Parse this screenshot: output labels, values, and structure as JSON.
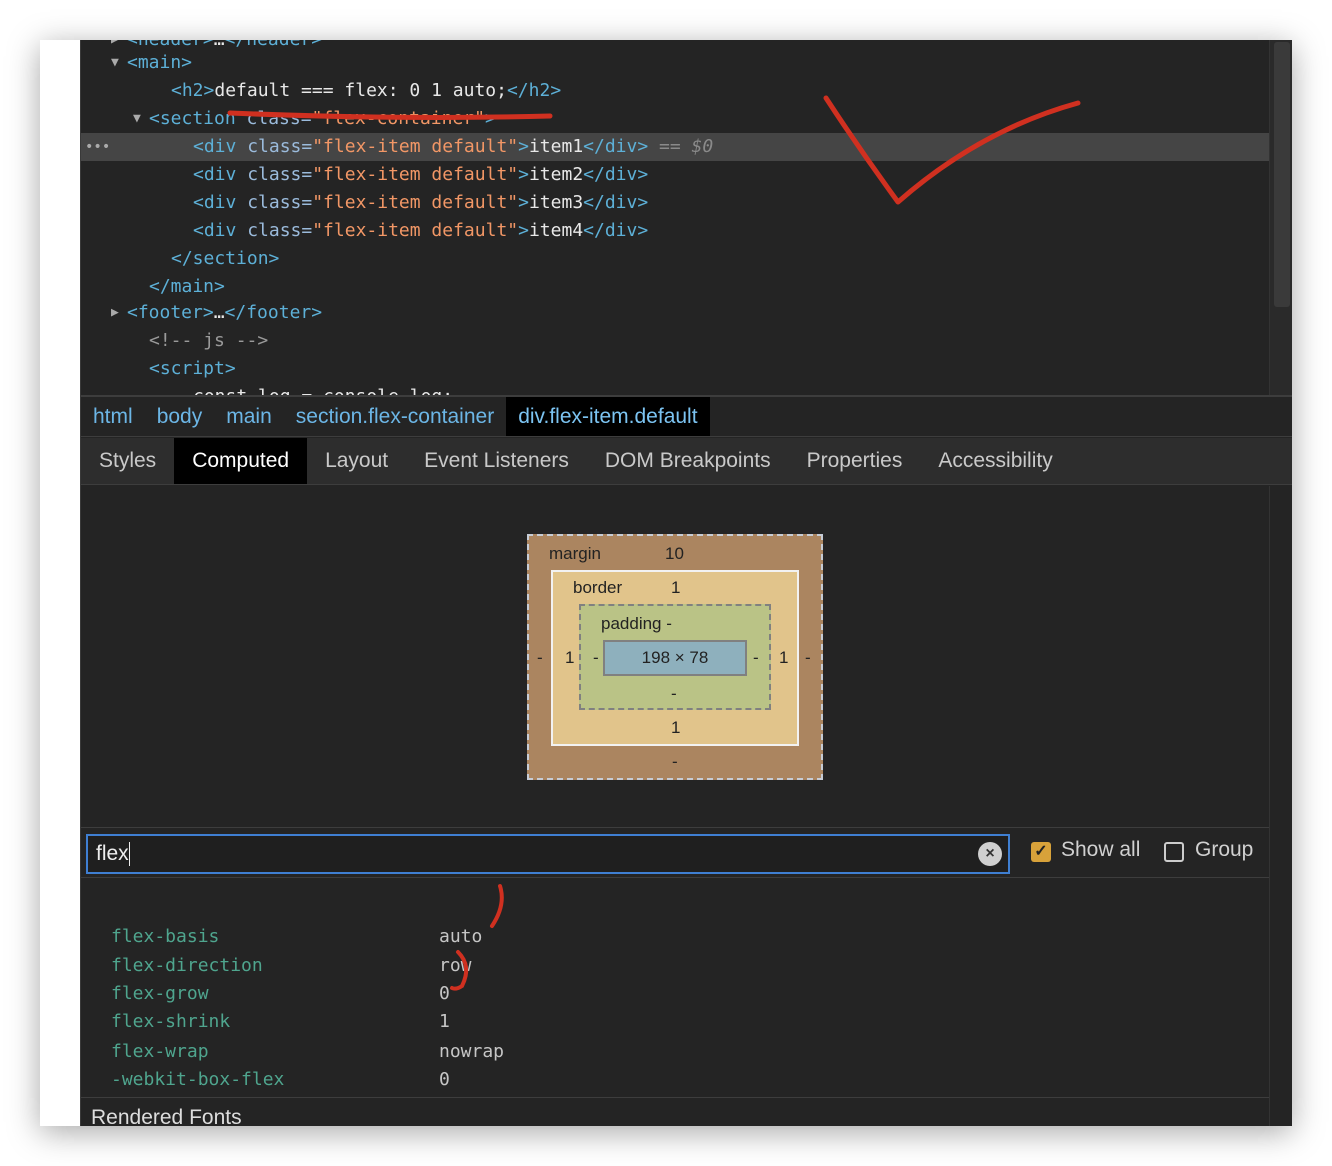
{
  "dom_tree": {
    "lines": [
      {
        "indent": 2,
        "tri": "▶",
        "parts": [
          [
            "tag",
            "<header>"
          ],
          [
            "txt",
            "…"
          ],
          [
            "tag",
            "</header>"
          ]
        ]
      },
      {
        "indent": 2,
        "tri": "▼",
        "parts": [
          [
            "tag",
            "<main>"
          ]
        ]
      },
      {
        "indent": 4,
        "tri": "",
        "parts": [
          [
            "tag",
            "<h2>"
          ],
          [
            "txt",
            "default === flex: 0 1 auto;"
          ],
          [
            "tag",
            "</h2>"
          ]
        ]
      },
      {
        "indent": 3,
        "tri": "▼",
        "parts": [
          [
            "tag",
            "<section "
          ],
          [
            "attr",
            "class="
          ],
          [
            "val",
            "\"flex-container\""
          ],
          [
            "tag",
            ">"
          ]
        ]
      },
      {
        "indent": 5,
        "tri": "",
        "selected": true,
        "parts": [
          [
            "tag",
            "<div "
          ],
          [
            "attr",
            "class="
          ],
          [
            "val",
            "\"flex-item default\""
          ],
          [
            "tag",
            ">"
          ],
          [
            "txt",
            "item1"
          ],
          [
            "tag",
            "</div>"
          ],
          [
            "dim",
            " == $0"
          ]
        ]
      },
      {
        "indent": 5,
        "tri": "",
        "parts": [
          [
            "tag",
            "<div "
          ],
          [
            "attr",
            "class="
          ],
          [
            "val",
            "\"flex-item default\""
          ],
          [
            "tag",
            ">"
          ],
          [
            "txt",
            "item2"
          ],
          [
            "tag",
            "</div>"
          ]
        ]
      },
      {
        "indent": 5,
        "tri": "",
        "parts": [
          [
            "tag",
            "<div "
          ],
          [
            "attr",
            "class="
          ],
          [
            "val",
            "\"flex-item default\""
          ],
          [
            "tag",
            ">"
          ],
          [
            "txt",
            "item3"
          ],
          [
            "tag",
            "</div>"
          ]
        ]
      },
      {
        "indent": 5,
        "tri": "",
        "parts": [
          [
            "tag",
            "<div "
          ],
          [
            "attr",
            "class="
          ],
          [
            "val",
            "\"flex-item default\""
          ],
          [
            "tag",
            ">"
          ],
          [
            "txt",
            "item4"
          ],
          [
            "tag",
            "</div>"
          ]
        ]
      },
      {
        "indent": 4,
        "tri": "",
        "parts": [
          [
            "tag",
            "</section>"
          ]
        ]
      },
      {
        "indent": 3,
        "tri": "",
        "parts": [
          [
            "tag",
            "</main>"
          ]
        ]
      },
      {
        "indent": 2,
        "tri": "▶",
        "parts": [
          [
            "tag",
            "<footer>"
          ],
          [
            "txt",
            "…"
          ],
          [
            "tag",
            "</footer>"
          ]
        ]
      },
      {
        "indent": 3,
        "tri": "",
        "parts": [
          [
            "cm",
            "<!-- js -->"
          ]
        ]
      },
      {
        "indent": 3,
        "tri": "",
        "parts": [
          [
            "tag",
            "<script>"
          ]
        ]
      },
      {
        "indent": 5,
        "tri": "",
        "parts": [
          [
            "txt",
            "const log = console.log;"
          ]
        ]
      }
    ],
    "selected_marker": "•••"
  },
  "breadcrumbs": [
    "html",
    "body",
    "main",
    "section.flex-container",
    "div.flex-item.default"
  ],
  "tabs": [
    "Styles",
    "Computed",
    "Layout",
    "Event Listeners",
    "DOM Breakpoints",
    "Properties",
    "Accessibility"
  ],
  "active_tab": "Computed",
  "box_model": {
    "margin_label": "margin",
    "margin_top": "10",
    "margin_left": "-",
    "margin_right": "-",
    "margin_bottom": "-",
    "border_label": "border",
    "border_top": "1",
    "border_left": "1",
    "border_right": "1",
    "border_bottom": "1",
    "padding_label": "padding",
    "padding_top": "-",
    "padding_left": "-",
    "padding_right": "-",
    "padding_bottom": "-",
    "content": "198 × 78",
    "colors": {
      "margin": "#ab8560",
      "border": "#e1c48b",
      "padding": "#bac386",
      "content": "#8eb0bd"
    }
  },
  "filter": {
    "value": "flex",
    "clear_icon": "×"
  },
  "show_all": {
    "label": "Show all",
    "checked": true
  },
  "group": {
    "label": "Group",
    "checked": false
  },
  "properties": [
    {
      "name": "flex-basis",
      "value": "auto"
    },
    {
      "name": "flex-direction",
      "value": "row"
    },
    {
      "name": "flex-grow",
      "value": "0"
    },
    {
      "name": "flex-shrink",
      "value": "1"
    },
    {
      "name": "flex-wrap",
      "value": "nowrap"
    },
    {
      "name": "-webkit-box-flex",
      "value": "0"
    }
  ],
  "rendered_fonts": "Rendered Fonts",
  "colors": {
    "accent": "#3f7fd2",
    "checkbox": "#d8a23a",
    "annotation": "#d03020"
  }
}
